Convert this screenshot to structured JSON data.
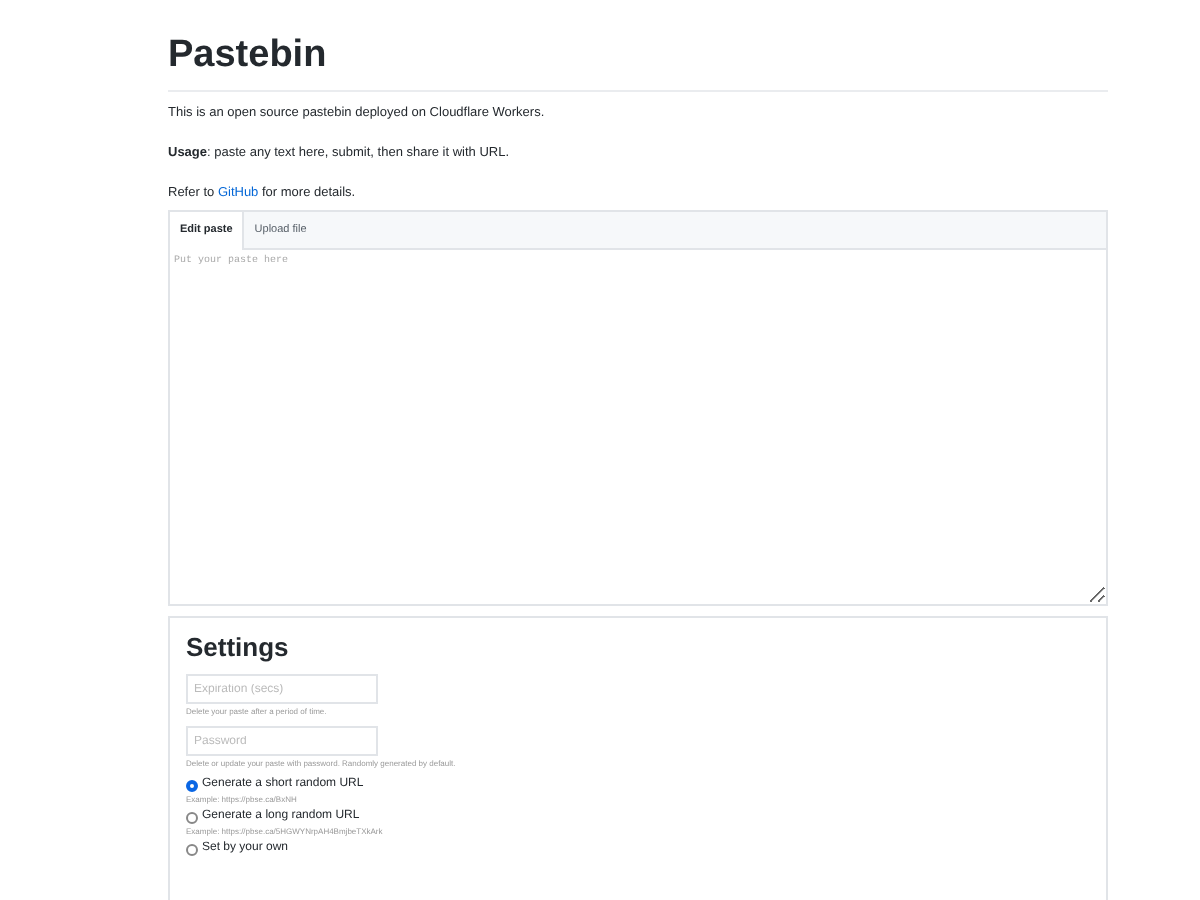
{
  "title": "Pastebin",
  "intro": "This is an open source pastebin deployed on Cloudflare Workers.",
  "usage": "**Usage**: paste any text here, submit, then share it with URL.",
  "refer": {
    "before": "Refer to",
    "link": "GitHub",
    "after": "for more details."
  },
  "tabs": [
    {
      "label": "Edit paste",
      "selected": true
    },
    {
      "label": "Upload file",
      "selected": false
    }
  ],
  "editor": {
    "placeholder": "Put your paste here"
  },
  "settings": {
    "title": "Settings",
    "fields": [
      {
        "placeholder": "Expiration (secs)",
        "hint": "Delete your paste after a period of time."
      },
      {
        "placeholder": "Password",
        "hint": "Delete or update your paste with password. Randomly generated by default."
      }
    ],
    "url_options": [
      {
        "label": "Generate a short random URL",
        "example": "Example: https://pbse.ca/BxNH",
        "selected": true
      },
      {
        "label": "Generate a long random URL",
        "example": "Example: https://pbse.ca/5HGWYNrpAH4BmjbeTXkArk",
        "selected": false
      },
      {
        "label": "Set by your own",
        "selected": false
      }
    ]
  }
}
